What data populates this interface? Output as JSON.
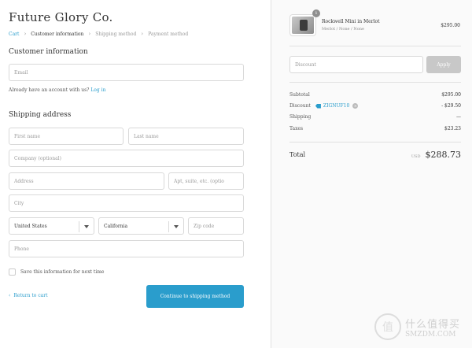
{
  "store": {
    "name": "Future Glory Co."
  },
  "breadcrumb": {
    "items": [
      "Cart",
      "Customer information",
      "Shipping method",
      "Payment method"
    ]
  },
  "customer": {
    "title": "Customer information",
    "email_placeholder": "Email",
    "account_text": "Already have an account with us?",
    "login_link": "Log in"
  },
  "shipping": {
    "title": "Shipping address",
    "first_name_placeholder": "First name",
    "last_name_placeholder": "Last name",
    "company_placeholder": "Company (optional)",
    "address_placeholder": "Address",
    "apt_placeholder": "Apt, suite, etc. (optio",
    "city_placeholder": "City",
    "country": "United States",
    "state": "California",
    "zip_placeholder": "Zip code",
    "phone_placeholder": "Phone",
    "save_label": "Save this information for next time"
  },
  "actions": {
    "return_label": "Return to cart",
    "continue_label": "Continue to shipping method"
  },
  "order": {
    "product_name": "Rockwell Mini in Merlot",
    "product_variant": "Merlot / None / None",
    "product_price": "$295.00",
    "quantity": "1",
    "discount_placeholder": "Discount",
    "apply_label": "Apply",
    "subtotal_label": "Subtotal",
    "subtotal_value": "$295.00",
    "discount_label": "Discount",
    "discount_code": "ZIGNUF10",
    "discount_value": "- $29.50",
    "shipping_label": "Shipping",
    "shipping_value": "—",
    "taxes_label": "Taxes",
    "taxes_value": "$23.23",
    "total_label": "Total",
    "currency": "USD",
    "total_value": "$288.73"
  },
  "watermark": {
    "line1": "什么值得买",
    "line2": "SMZDM.COM"
  },
  "colors": {
    "accent": "#2a9dcc",
    "apply_disabled": "#c8c8c8"
  }
}
